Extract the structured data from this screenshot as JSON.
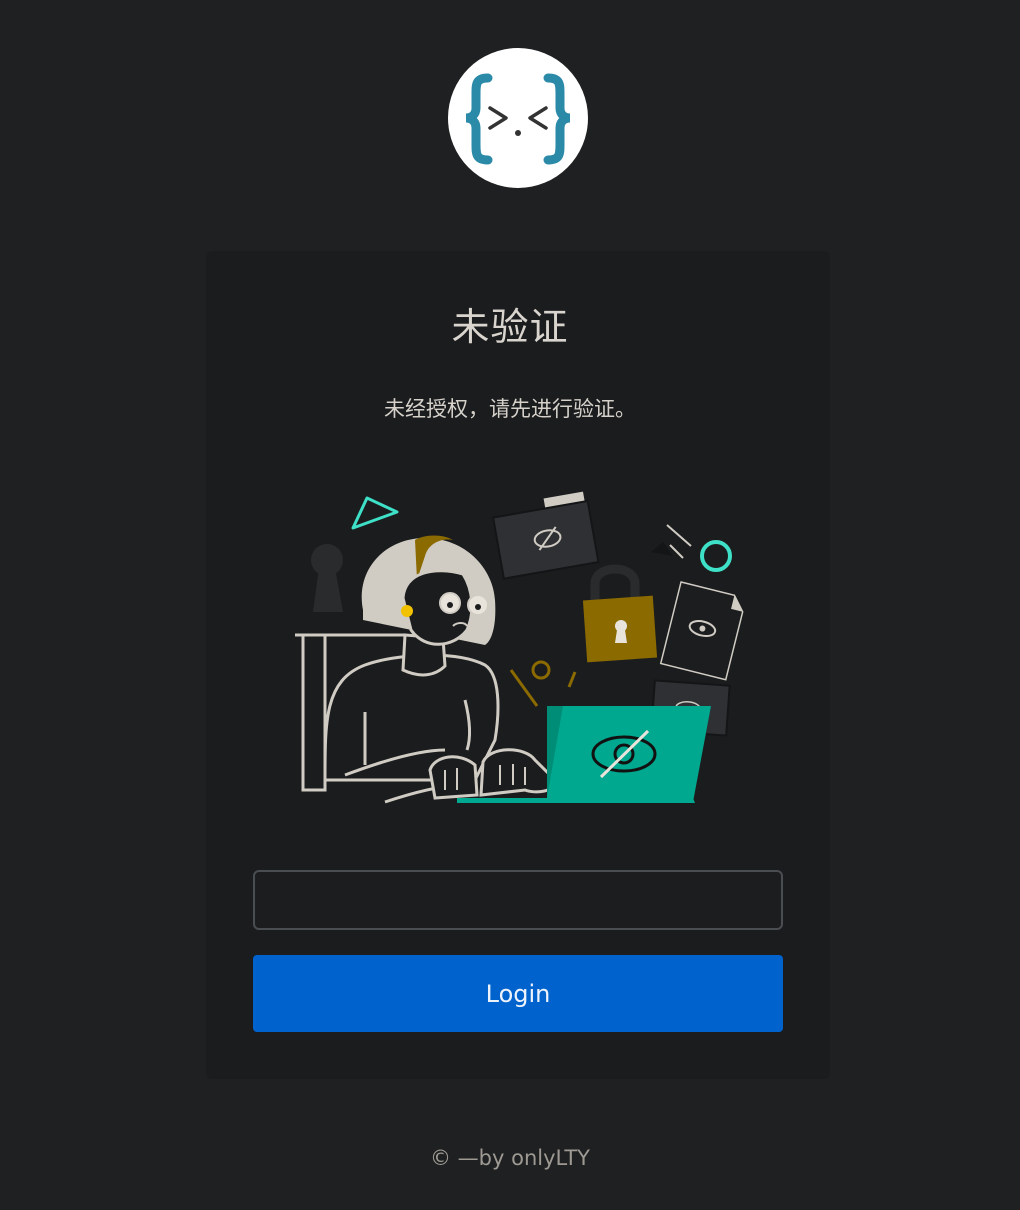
{
  "logo": {
    "icon": "curly-brace-face-logo",
    "glyph": ">.<"
  },
  "card": {
    "title": "未验证",
    "subtitle": "未经授权，请先进行验证。",
    "illustration": "person-with-locked-laptop-illustration"
  },
  "form": {
    "input_value": "",
    "input_placeholder": "",
    "login_label": "Login"
  },
  "footer": {
    "text": "© —by onlyLTY"
  },
  "colors": {
    "background": "#1e2022",
    "card": "#1b1c1e",
    "button": "#0062cc",
    "accent_teal": "#00a88f",
    "accent_gold": "#8b6a00",
    "logo_blue": "#2a8aa8"
  }
}
